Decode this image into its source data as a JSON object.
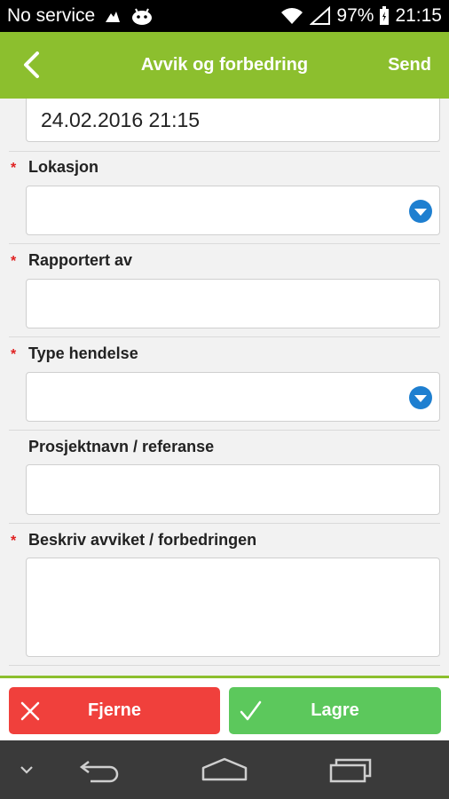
{
  "status_bar": {
    "carrier": "No service",
    "battery": "97%",
    "time": "21:15"
  },
  "app_bar": {
    "title": "Avvik og forbedring",
    "send_label": "Send"
  },
  "form": {
    "date_value": "24.02.2016 21:15",
    "required_marker": "*",
    "fields": [
      {
        "label": "Lokasjon",
        "required": true,
        "type": "dropdown",
        "value": ""
      },
      {
        "label": "Rapportert av",
        "required": true,
        "type": "text",
        "value": ""
      },
      {
        "label": "Type hendelse",
        "required": true,
        "type": "dropdown",
        "value": ""
      },
      {
        "label": "Prosjektnavn / referanse",
        "required": false,
        "type": "text",
        "value": ""
      },
      {
        "label": "Beskriv avviket / forbedringen",
        "required": true,
        "type": "textarea",
        "value": ""
      }
    ]
  },
  "actions": {
    "remove_label": "Fjerne",
    "save_label": "Lagre"
  },
  "colors": {
    "accent": "#8cbf2e",
    "remove": "#f0403c",
    "save": "#5cc85c",
    "dropdown": "#1e7fd0",
    "required": "#e02020"
  },
  "icons": {
    "back": "chevron-left-icon",
    "dropdown": "chevron-down-circle-icon",
    "remove": "close-icon",
    "save": "checkmark-icon",
    "nav": [
      "chevron-down-icon",
      "back-arrow-icon",
      "home-icon",
      "recent-apps-icon"
    ]
  }
}
